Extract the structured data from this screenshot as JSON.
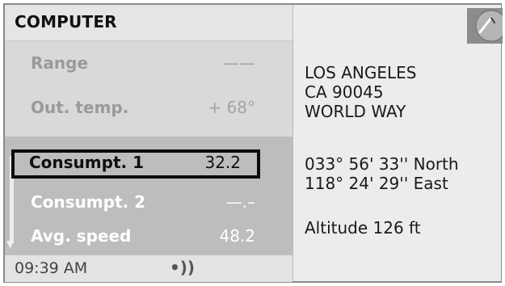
{
  "menu": {
    "title": "COMPUTER",
    "items": [
      {
        "label": "Range",
        "value": "——"
      },
      {
        "label": "Out. temp.",
        "value": "+ 68°"
      },
      {
        "label": "Consumpt. 1",
        "value": "32.2"
      },
      {
        "label": "Consumpt. 2",
        "value": "—.–"
      },
      {
        "label": "Avg. speed",
        "value": "48.2"
      }
    ]
  },
  "status": {
    "time": "09:39 AM",
    "signal_icon": "signal-waves-icon",
    "signal_glyph": "•))"
  },
  "info": {
    "address": {
      "city": "LOS ANGELES",
      "zip": "CA 90045",
      "street": "WORLD WAY"
    },
    "coordinates": {
      "latitude": "033° 56' 33'' North",
      "longitude": "118° 24' 29'' East"
    },
    "altitude": "Altitude 126 ft",
    "compass_icon": "compass-icon"
  },
  "colors": {
    "panel_bg": "#d9d9d9",
    "lower_band": "#bdbdbd",
    "info_bg": "#ececec",
    "focus_frame": "#0c0c0c"
  }
}
